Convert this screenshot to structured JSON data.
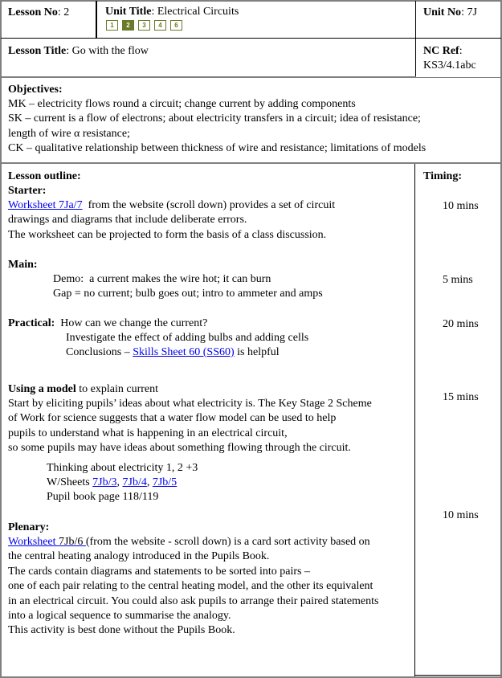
{
  "header": {
    "lesson_no_label": "Lesson No",
    "lesson_no_value": ": 2",
    "unit_title_label": "Unit Title",
    "unit_title_value": ": Electrical Circuits",
    "unit_no_label": "Unit No",
    "unit_no_value": ": 7J",
    "lesson_nav": [
      {
        "label": "1",
        "active": false
      },
      {
        "label": "2",
        "active": true
      },
      {
        "label": "3",
        "active": false
      },
      {
        "label": "4",
        "active": false
      },
      {
        "label": "6",
        "active": false
      }
    ],
    "accent_color": "#6b7a2a"
  },
  "title_row": {
    "lesson_title_label": "Lesson Title",
    "lesson_title_value": ": Go with the flow",
    "nc_ref_label": "NC Ref",
    "nc_ref_colon": ":",
    "nc_ref_value": "KS3/4.1abc"
  },
  "objectives": {
    "heading": "Objectives:",
    "lines": [
      "MK – electricity flows round a circuit; change current by adding components",
      "SK – current is a flow of electrons; about electricity transfers in a circuit; idea of resistance;",
      "length of wire α resistance;",
      "CK – qualitative relationship between thickness of wire and resistance; limitations of models"
    ]
  },
  "outline": {
    "heading": "Lesson outline:",
    "timing_heading": "Timing:",
    "starter": {
      "heading": "Starter:",
      "link": "Worksheet 7Ja/7",
      "line1_rest": "  from the website (scroll down) provides a set of circuit",
      "line2": "drawings and diagrams that include deliberate errors.",
      "line3": "The worksheet can be projected to form the basis of a class discussion.",
      "timing": "10 mins"
    },
    "main": {
      "heading": "Main:",
      "line1": "Demo:  a current makes the wire hot; it can burn",
      "line2": "Gap = no current; bulb goes out; intro to ammeter and amps",
      "timing": "5 mins"
    },
    "practical": {
      "heading": "Practical:",
      "line1": "  How can we change the current?",
      "line2": "Investigate the effect of adding bulbs and adding cells",
      "line3_prefix": "Conclusions – ",
      "line3_link": "Skills Sheet 60 (SS60)",
      "line3_suffix": " is helpful",
      "timing": "20 mins"
    },
    "model": {
      "heading_bold": "Using a model",
      "heading_rest": " to explain current",
      "lines": [
        "Start by eliciting pupils’ ideas about what electricity is. The Key Stage 2 Scheme",
        "of Work for science suggests that a water flow model can be used to help",
        "pupils to understand what is happening in an electrical circuit,",
        "so some pupils may have ideas about something flowing through the circuit."
      ],
      "thinking": "Thinking about electricity 1, 2 +3",
      "wsheets_prefix": "W/Sheets ",
      "wsheet_links": [
        "7Jb/3",
        "7Jb/4",
        "7Jb/5"
      ],
      "pupil_book": "Pupil book page 118/119",
      "timing": "15 mins"
    },
    "plenary": {
      "heading": "Plenary:",
      "link": "Worksheet ",
      "link_rest": "7Jb/6 ",
      "line1_rest": "(from the website - scroll down) is a card sort activity based on",
      "lines": [
        "the central heating analogy introduced in the Pupils Book.",
        "The cards contain diagrams and statements to be sorted into pairs –",
        "one of each pair relating to the central heating model, and the other its equivalent",
        "in an electrical circuit. You could also ask pupils to arrange their paired statements",
        "into a logical sequence to summarise the analogy.",
        "This activity is best done without the Pupils Book."
      ],
      "timing": "10 mins"
    }
  }
}
